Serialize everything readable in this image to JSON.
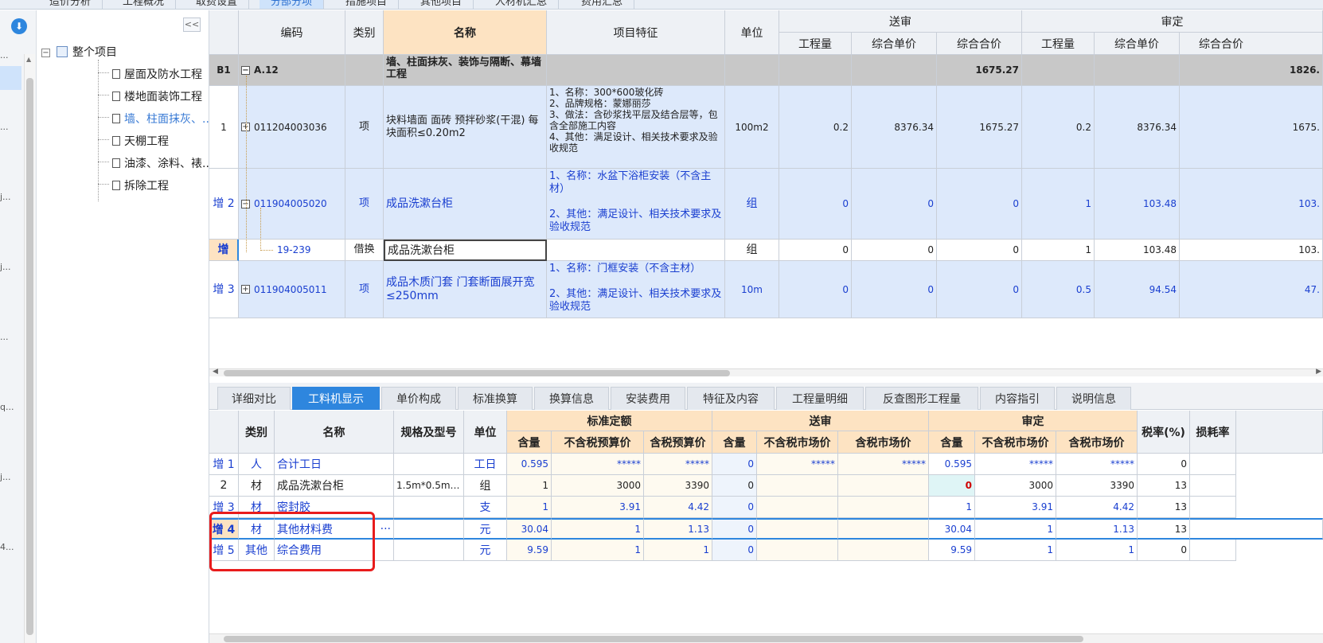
{
  "top_tabs": [
    "造价分析",
    "工程概况",
    "取费设置",
    "分部分项",
    "措施项目",
    "其他项目",
    "人材机汇总",
    "费用汇总"
  ],
  "rail": {
    "download_icon": "download-icon",
    "dots": [
      "...",
      "...",
      "...",
      "j...",
      "j...",
      "...",
      "q...",
      "j...",
      "4..."
    ]
  },
  "tree": {
    "collapse_label": "<<",
    "root": "整个项目",
    "items": [
      "屋面及防水工程",
      "楼地面装饰工程",
      "墙、柱面抹灰、...",
      "天棚工程",
      "油漆、涂料、裱...",
      "拆除工程"
    ],
    "selected_index": 2
  },
  "upper_grid": {
    "headers": {
      "code": "编码",
      "type": "类别",
      "name": "名称",
      "feature": "项目特征",
      "unit": "单位",
      "sent": "送审",
      "audit": "审定",
      "qty": "工程量",
      "unit_price": "综合单价",
      "total": "综合合价"
    },
    "group_row": {
      "id": "B1",
      "code": "A.12",
      "name": "墙、柱面抹灰、装饰与隔断、幕墙工程",
      "sent_total": "1675.27",
      "audit_total": "1826."
    },
    "rows": [
      {
        "id": "1",
        "code": "011204003036",
        "type": "项",
        "name": "块料墙面 面砖 预拌砂浆(干混) 每块面积≤0.20m2",
        "feature": "1、名称：300*600玻化砖\n2、品牌规格：蒙娜丽莎\n3、做法：含砂浆找平层及结合层等，包含全部施工内容\n4、其他：满足设计、相关技术要求及验收规范",
        "unit": "100m2",
        "s_qty": "0.2",
        "s_price": "8376.34",
        "s_total": "1675.27",
        "a_qty": "0.2",
        "a_price": "8376.34",
        "a_total": "1675."
      },
      {
        "id": "增 2",
        "code": "011904005020",
        "type": "项",
        "name": "成品洗漱台柜",
        "feature": "1、名称：水盆下浴柜安装（不含主材）\n\n2、其他：满足设计、相关技术要求及验收规范",
        "unit": "组",
        "s_qty": "0",
        "s_price": "0",
        "s_total": "0",
        "a_qty": "1",
        "a_price": "103.48",
        "a_total": "103."
      },
      {
        "id": "增",
        "code": "19-239",
        "type": "借换",
        "name": "成品洗漱台柜",
        "feature": "",
        "unit": "组",
        "s_qty": "0",
        "s_price": "0",
        "s_total": "0",
        "a_qty": "1",
        "a_price": "103.48",
        "a_total": "103."
      },
      {
        "id": "增 3",
        "code": "011904005011",
        "type": "项",
        "name": "成品木质门套 门套断面展开宽 ≤250mm",
        "feature": "1、名称：门框安装（不含主材）\n\n2、其他：满足设计、相关技术要求及验收规范",
        "unit": "10m",
        "s_qty": "0",
        "s_price": "0",
        "s_total": "0",
        "a_qty": "0.5",
        "a_price": "94.54",
        "a_total": "47."
      }
    ]
  },
  "lower_tabs": [
    "详细对比",
    "工料机显示",
    "单价构成",
    "标准换算",
    "换算信息",
    "安装费用",
    "特征及内容",
    "工程量明细",
    "反查图形工程量",
    "内容指引",
    "说明信息"
  ],
  "lower_active": 1,
  "lower_grid": {
    "headers": {
      "type": "类别",
      "name": "名称",
      "spec": "规格及型号",
      "unit": "单位",
      "std": "标准定额",
      "sent": "送审",
      "audit": "审定",
      "tax": "税率(%)",
      "loss": "损耗率",
      "qty": "含量",
      "std_nt": "不含税预算价",
      "std_t": "含税预算价",
      "mkt_nt": "不含税市场价",
      "mkt_t": "含税市场价"
    },
    "rows": [
      {
        "id": "增 1",
        "type": "人",
        "name": "合计工日",
        "spec": "",
        "unit": "工日",
        "q": "0.595",
        "p1": "*****",
        "p2": "*****",
        "sq": "0",
        "sp1": "*****",
        "sp2": "*****",
        "aq": "0.595",
        "ap1": "*****",
        "ap2": "*****",
        "tax": "0"
      },
      {
        "id": "2",
        "type": "材",
        "name": "成品洗漱台柜",
        "spec": "1.5m*0.5m…",
        "unit": "组",
        "q": "1",
        "p1": "3000",
        "p2": "3390",
        "sq": "0",
        "sp1": "",
        "sp2": "",
        "aq": "0",
        "ap1": "3000",
        "ap2": "3390",
        "tax": "13"
      },
      {
        "id": "增 3",
        "type": "材",
        "name": "密封胶",
        "spec": "",
        "unit": "支",
        "q": "1",
        "p1": "3.91",
        "p2": "4.42",
        "sq": "0",
        "sp1": "",
        "sp2": "",
        "aq": "1",
        "ap1": "3.91",
        "ap2": "4.42",
        "tax": "13"
      },
      {
        "id": "增 4",
        "type": "材",
        "name": "其他材料费",
        "spec": "",
        "unit": "元",
        "q": "30.04",
        "p1": "1",
        "p2": "1.13",
        "sq": "0",
        "sp1": "",
        "sp2": "",
        "aq": "30.04",
        "ap1": "1",
        "ap2": "1.13",
        "tax": "13"
      },
      {
        "id": "增 5",
        "type": "其他",
        "name": "综合费用",
        "spec": "",
        "unit": "元",
        "q": "9.59",
        "p1": "1",
        "p2": "1",
        "sq": "0",
        "sp1": "",
        "sp2": "",
        "aq": "9.59",
        "ap1": "1",
        "ap2": "1",
        "tax": "0"
      }
    ],
    "more_button": "···"
  },
  "colors": {
    "accent": "#2e86de",
    "header_orange": "#fde3c2",
    "row_blue": "#dde9fb",
    "annotation_red": "#e81c1c",
    "blue_text": "#1a3fd0",
    "warn_red": "#d00000"
  }
}
